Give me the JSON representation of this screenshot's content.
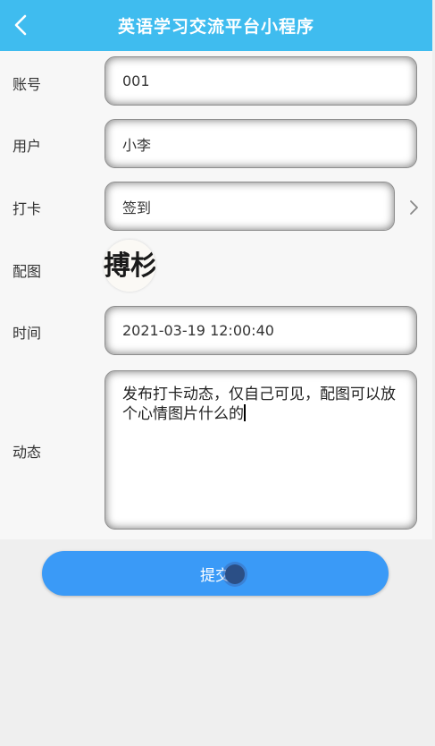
{
  "header": {
    "title": "英语学习交流平台小程序"
  },
  "form": {
    "account": {
      "label": "账号",
      "value": "001"
    },
    "user": {
      "label": "用户",
      "value": "小李"
    },
    "checkin": {
      "label": "打卡",
      "value": "签到"
    },
    "image": {
      "label": "配图",
      "image_text": "搏杉"
    },
    "time": {
      "label": "时间",
      "value": "2021-03-19 12:00:40"
    },
    "dynamic": {
      "label": "动态",
      "value": "发布打卡动态，仅自己可见，配图可以放个心情图片什么的"
    }
  },
  "submit": {
    "label": "提交"
  },
  "colors": {
    "header": "#3fbcef",
    "accent": "#3a9af7"
  }
}
